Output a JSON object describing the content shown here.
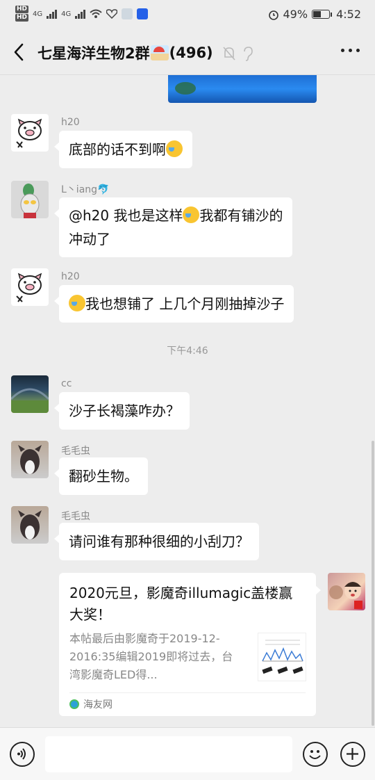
{
  "status_bar": {
    "hd_labels": [
      "HD",
      "HD"
    ],
    "network": [
      "4G",
      "4G"
    ],
    "battery": "49%",
    "time": "4:52"
  },
  "header": {
    "title": "七星海洋生物2群",
    "member_count": "(496)",
    "icons": [
      "back-arrow-icon",
      "mute-bell-icon",
      "ear-icon",
      "more-icon"
    ]
  },
  "messages": [
    {
      "sender": "h20",
      "avatar": "pig-avatar",
      "text": "底部的话不到啊",
      "trailing_emoji": true
    },
    {
      "sender": "L丶iang🐬",
      "avatar": "ultraman-avatar",
      "line1_pre": "@h20  我也是这样",
      "line1_post": "我都有铺沙的",
      "line2": "冲动了"
    },
    {
      "sender": "h20",
      "avatar": "pig-avatar",
      "text": "我也想铺了 上几个月刚抽掉沙子",
      "leading_emoji": true
    },
    {
      "sender": "cc",
      "avatar": "landscape-avatar",
      "text": "沙子长褐藻咋办？"
    },
    {
      "sender": "毛毛虫",
      "avatar": "dog-avatar",
      "text": "翻砂生物。"
    },
    {
      "sender": "毛毛虫",
      "avatar": "dog-avatar",
      "text": "请问谁有那种很细的小刮刀？"
    }
  ],
  "timestamp": "下午4:46",
  "link_card": {
    "title": "2020元旦，影魔奇illumagic盖楼赢大奖！",
    "description": "本帖最后由影魔奇于2019-12-2016:35编辑2019即将过去，台湾影魔奇LED得...",
    "source": "海友网"
  },
  "colors": {
    "background": "#ededed",
    "bubble": "#ffffff",
    "meta_text": "#8a8a8a"
  }
}
